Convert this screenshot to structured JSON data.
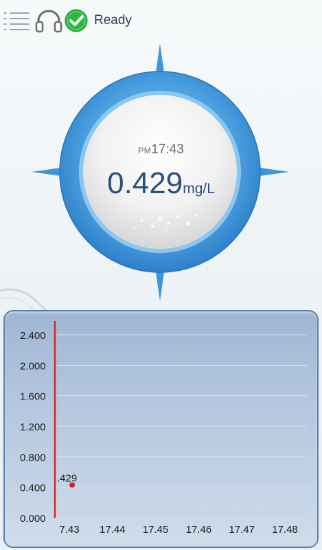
{
  "status": {
    "label": "Ready"
  },
  "dial": {
    "period": "PM",
    "time": "17:43",
    "value": "0.429",
    "unit": "mg/L"
  },
  "colors": {
    "accent": "#3a8ed8",
    "value_text": "#2d4f7f",
    "series": "#dd2222",
    "ok": "#2fb541"
  },
  "icons": [
    "menu-icon",
    "headset-icon",
    "check-circle-icon"
  ],
  "chart_data": {
    "type": "scatter",
    "ylim": [
      0,
      2.4
    ],
    "y_ticks": [
      "0.000",
      "0.400",
      "0.800",
      "1.200",
      "1.600",
      "2.000",
      "2.400"
    ],
    "x_ticks": [
      "7.43",
      "17.44",
      "17.45",
      "17.46",
      "17.47",
      "17.48"
    ],
    "series": [
      {
        "points": [
          {
            "x": 17.43,
            "y": 0.429,
            "label": ".429"
          }
        ]
      }
    ],
    "grid": true
  }
}
